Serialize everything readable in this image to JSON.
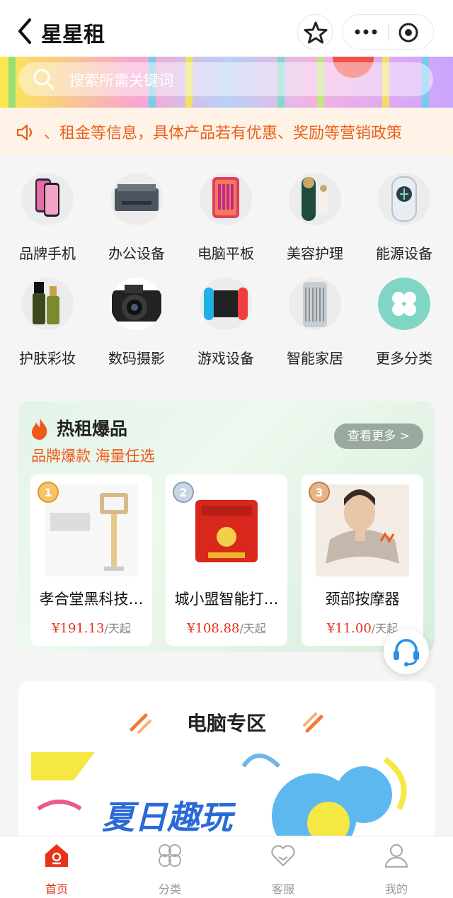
{
  "nav": {
    "title": "星星租"
  },
  "search": {
    "placeholder": "搜索所需关键词"
  },
  "notice": {
    "text": "、租金等信息，具体产品若有优惠、奖励等营销政策"
  },
  "categories": [
    {
      "label": "品牌手机",
      "icon": "phone-icon"
    },
    {
      "label": "办公设备",
      "icon": "printer-icon"
    },
    {
      "label": "电脑平板",
      "icon": "tablet-icon"
    },
    {
      "label": "美容护理",
      "icon": "beauty-device-icon"
    },
    {
      "label": "能源设备",
      "icon": "charger-icon"
    },
    {
      "label": "护肤彩妆",
      "icon": "skincare-icon"
    },
    {
      "label": "数码摄影",
      "icon": "camera-icon"
    },
    {
      "label": "游戏设备",
      "icon": "game-console-icon"
    },
    {
      "label": "智能家居",
      "icon": "smart-home-icon"
    },
    {
      "label": "更多分类",
      "icon": "clover-icon"
    }
  ],
  "hot": {
    "title": "热租爆品",
    "subtitle": "品牌爆款 海量任选",
    "more": "查看更多 >",
    "items": [
      {
        "rank": "1",
        "name": "孝合堂黑科技…",
        "price": "¥191.13",
        "unit": "/天起"
      },
      {
        "rank": "2",
        "name": "城小盟智能打…",
        "price": "¥108.88",
        "unit": "/天起"
      },
      {
        "rank": "3",
        "name": "颈部按摩器",
        "price": "¥11.00",
        "unit": "/天起"
      }
    ]
  },
  "pc_section": {
    "title": "电脑专区",
    "banner_text": "夏日趣玩"
  },
  "tabs": [
    {
      "label": "首页",
      "active": true
    },
    {
      "label": "分类",
      "active": false
    },
    {
      "label": "客服",
      "active": false
    },
    {
      "label": "我的",
      "active": false
    }
  ],
  "colors": {
    "accent": "#e8321a",
    "notice": "#e8621a",
    "teal": "#7fd6c4"
  }
}
